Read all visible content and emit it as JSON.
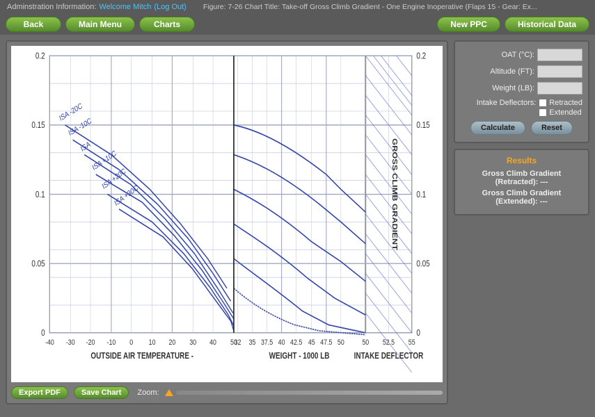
{
  "infoBar": {
    "adminLabel": "Adminstration Information:",
    "adminName": "Welcome Mitch",
    "logoutLabel": "(Log Out)",
    "figureInfo": "Figure: 7-26  Chart Title: Take-off Gross Climb Gradient - One Engine Inoperative (Flaps 15 - Gear: Ex..."
  },
  "nav": {
    "backLabel": "Back",
    "mainMenuLabel": "Main Menu",
    "chartsLabel": "Charts",
    "newPpcLabel": "New PPC",
    "historicalDataLabel": "Historical Data"
  },
  "inputs": {
    "oatLabel": "OAT (°C):",
    "altitudeLabel": "Altitude (FT):",
    "weightLabel": "Weight (LB):",
    "intakeDeflectorsLabel": "Intake Deflectors:",
    "retractedLabel": "Retracted",
    "extendedLabel": "Extended"
  },
  "buttons": {
    "calculateLabel": "Calculate",
    "resetLabel": "Reset",
    "exportPdfLabel": "Export PDF",
    "saveChartLabel": "Save Chart",
    "zoomLabel": "Zoom:"
  },
  "results": {
    "title": "Results",
    "grossClimbRetractedLabel": "Gross Climb Gradient",
    "grossClimbRetractedSuffix": "(Retracted): ---",
    "grossClimbExtendedLabel": "Gross Climb Gradient",
    "grossClimbExtendedSuffix": "(Extended): ---"
  },
  "chart": {
    "xAxisLeftLabel": "OUTSIDE AIR TEMPERATURE -",
    "xAxisMiddleLabel": "WEIGHT - 1000 LB",
    "xAxisRightLabel": "INTAKE DEFLECTOR",
    "yAxisLabel": "GROSS CLIMB GRADIENT",
    "xTicksLeft": [
      "-40",
      "-30",
      "-20",
      "-10",
      "0",
      "10",
      "20",
      "30",
      "40",
      "50"
    ],
    "xTicksMiddle": [
      "32",
      "32.5",
      "35",
      "37.5",
      "40",
      "42.5",
      "45",
      "47.5",
      "50"
    ],
    "xTicksRight": [
      "50",
      "52.5",
      "55"
    ],
    "yTicks": [
      "0",
      "0.05",
      "0.1",
      "0.15",
      "0.2"
    ],
    "isaLabels": [
      "ISA -20C",
      "ISA -10C",
      "ISA",
      "ISA +10C",
      "ISA +20C",
      "ISA +30C"
    ]
  }
}
